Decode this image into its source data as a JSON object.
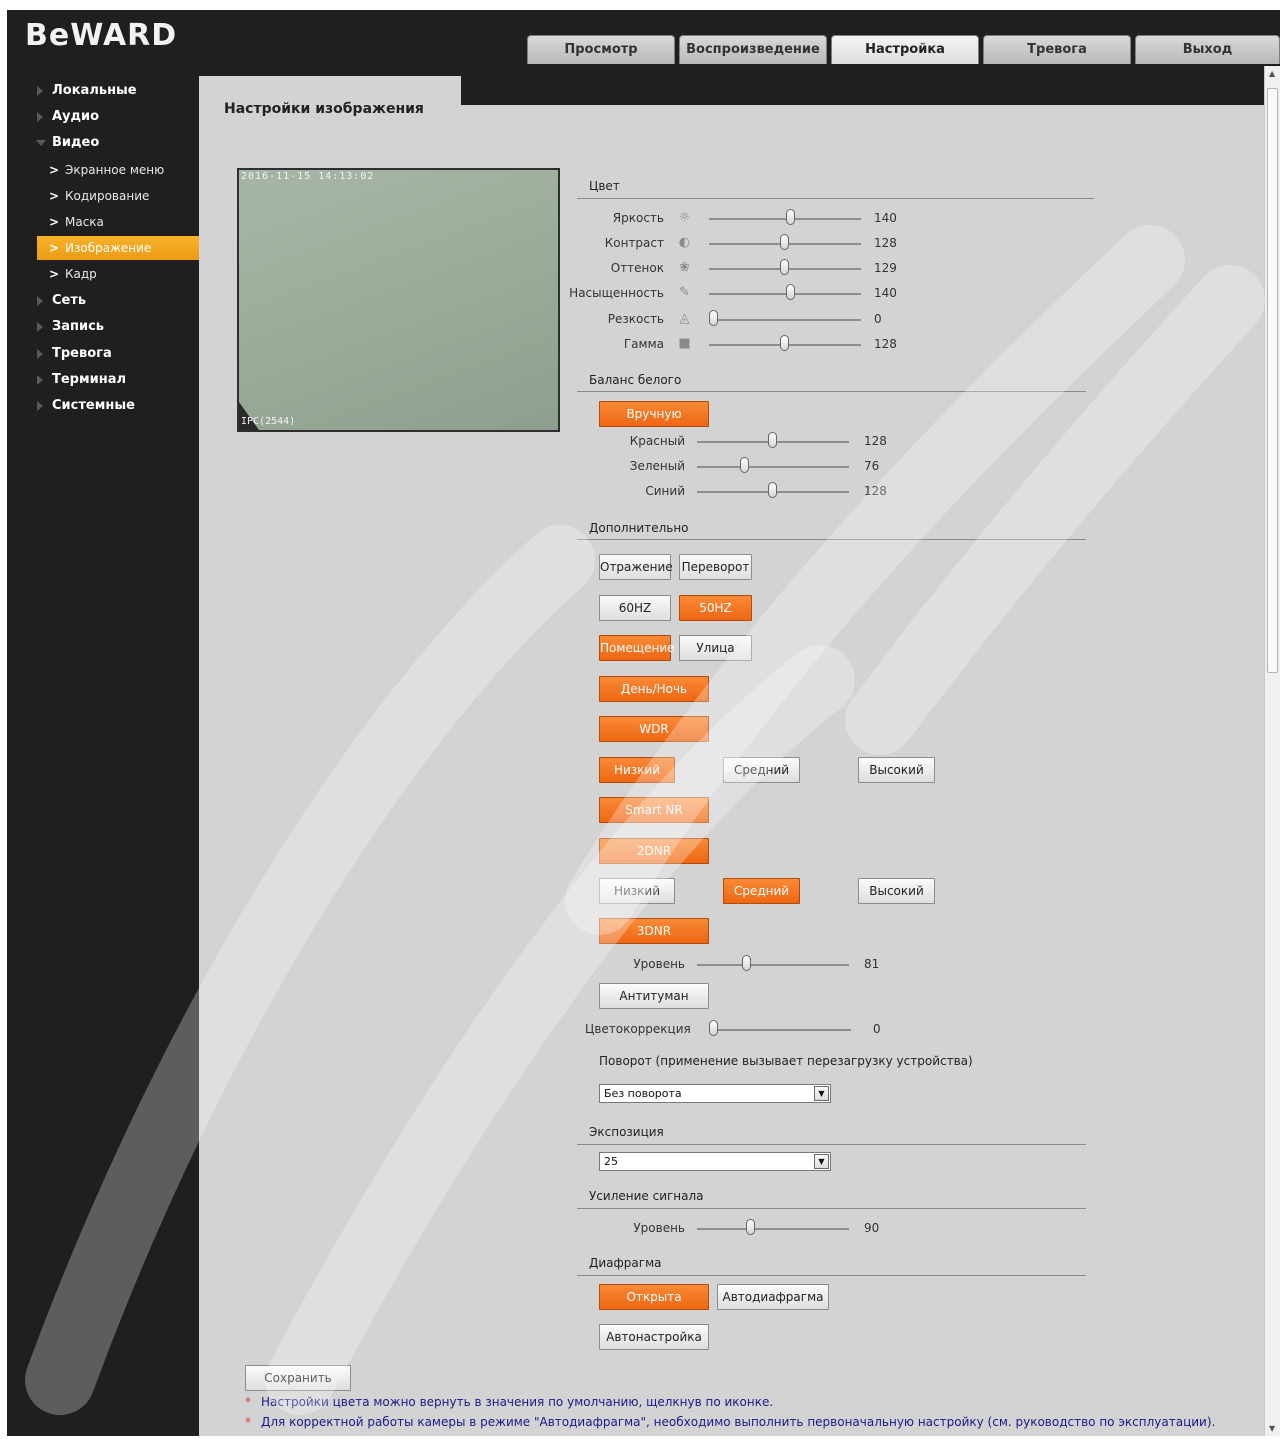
{
  "header": {
    "logo": "BeWARD",
    "tabs": [
      "Просмотр",
      "Воспроизведение",
      "Настройка",
      "Тревога",
      "Выход"
    ],
    "active_tab": "Настройка"
  },
  "sidebar": {
    "items": [
      {
        "label": "Локальные"
      },
      {
        "label": "Аудио"
      },
      {
        "label": "Видео"
      },
      {
        "label": "Экранное меню"
      },
      {
        "label": "Кодирование"
      },
      {
        "label": "Маска"
      },
      {
        "label": "Изображение"
      },
      {
        "label": "Кадр"
      },
      {
        "label": "Сеть"
      },
      {
        "label": "Запись"
      },
      {
        "label": "Тревога"
      },
      {
        "label": "Терминал"
      },
      {
        "label": "Системные"
      }
    ],
    "active": "Изображение"
  },
  "page": {
    "title": "Настройки изображения"
  },
  "preview": {
    "timestamp": "2016-11-15 14:13:02",
    "osd_name": "IPC(2544)"
  },
  "color": {
    "title": "Цвет",
    "brightness": {
      "label": "Яркость",
      "value": "140",
      "icon": "sun-icon",
      "level": 140
    },
    "contrast": {
      "label": "Контраст",
      "value": "128",
      "icon": "contrast-icon",
      "level": 128
    },
    "hue": {
      "label": "Оттенок",
      "value": "129",
      "icon": "palette-icon",
      "level": 129
    },
    "saturation": {
      "label": "Насыщенность",
      "value": "140",
      "icon": "dropper-icon",
      "level": 140
    },
    "sharpness": {
      "label": "Резкость",
      "value": "0",
      "icon": "triangle-icon",
      "level": 0
    },
    "gamma": {
      "label": "Гамма",
      "value": "128",
      "icon": "square-icon",
      "level": 128
    }
  },
  "white_balance": {
    "title": "Баланс белого",
    "mode": "Вручную",
    "red": {
      "label": "Красный",
      "value": "128",
      "level": 128
    },
    "green": {
      "label": "Зеленый",
      "value": "76",
      "level": 76
    },
    "blue": {
      "label": "Синий",
      "value": "128",
      "level": 128
    }
  },
  "extra": {
    "title": "Дополнительно",
    "mirror": "Отражение",
    "flip": "Переворот",
    "hz60": "60HZ",
    "hz50": "50HZ",
    "indoor": "Помещение",
    "outdoor": "Улица",
    "daynight": "День/Ночь",
    "wdr": "WDR",
    "wdr_low": "Низкий",
    "wdr_mid": "Средний",
    "wdr_high": "Высокий",
    "smartnr": "Smart NR",
    "dnr2": "2DNR",
    "dnr2_low": "Низкий",
    "dnr2_mid": "Средний",
    "dnr2_high": "Высокий",
    "dnr3": "3DNR",
    "level_label": "Уровень",
    "level_value": "81",
    "level": 81,
    "defog": "Антитуман",
    "colorcorr_label": "Цветокоррекция",
    "colorcorr_value": "0",
    "colorcorr_level": 0,
    "rotate_label": "Поворот (применение вызывает перезагрузку устройства)",
    "rotate_value": "Без поворота"
  },
  "exposure": {
    "title": "Экспозиция",
    "value": "25"
  },
  "gain": {
    "title": "Усиление сигнала",
    "label": "Уровень",
    "value": "90",
    "level": 90
  },
  "iris": {
    "title": "Диафрагма",
    "open": "Открыта",
    "auto": "Автодиафрагма",
    "autoset": "Автонастройка"
  },
  "footer": {
    "save": "Сохранить",
    "star": "*",
    "note1": "Настройки цвета можно вернуть в значения по умолчанию, щелкнув по иконке.",
    "note2": "Для корректной работы камеры в режиме \"Автодиафрагма\", необходимо выполнить первоначальную настройку (см. руководство по эксплуатации)."
  },
  "colors": {
    "accent_orange": "#ee6714",
    "nav_active": "#f5a623",
    "frame": "#1f1f1f",
    "panel": "#d3d3d3"
  }
}
